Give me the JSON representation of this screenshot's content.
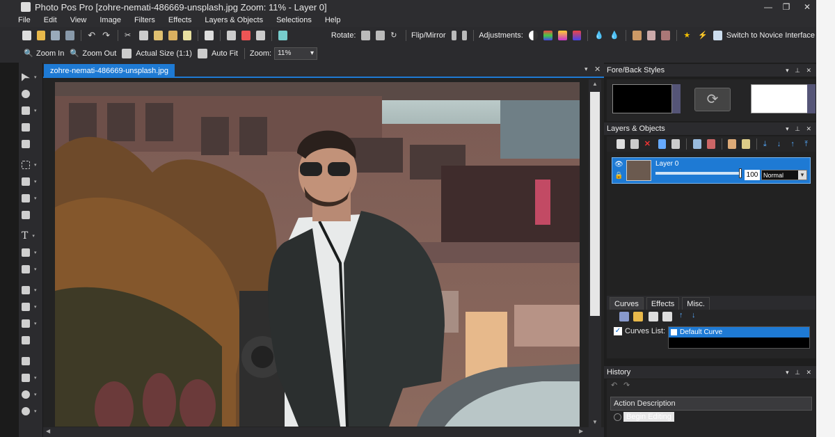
{
  "app": {
    "title": "Photo Pos Pro [zohre-nemati-486669-unsplash.jpg Zoom: 11% - Layer 0]"
  },
  "menu": [
    "File",
    "Edit",
    "View",
    "Image",
    "Filters",
    "Effects",
    "Layers & Objects",
    "Selections",
    "Help"
  ],
  "toolbar": {
    "rotate_label": "Rotate:",
    "flip_label": "Flip/Mirror",
    "adjustments_label": "Adjustments:",
    "novice_label": "Switch to Novice Interface",
    "zoom_in": "Zoom In",
    "zoom_out": "Zoom Out",
    "actual_size": "Actual Size (1:1)",
    "auto_fit": "Auto Fit",
    "zoom_label": "Zoom:",
    "zoom_value": "11%"
  },
  "document": {
    "tab": "zohre-nemati-486669-unsplash.jpg"
  },
  "panels": {
    "fore_back": "Fore/Back Styles",
    "layers": "Layers & Objects",
    "history": "History"
  },
  "layer": {
    "name": "Layer 0",
    "opacity": "100",
    "blend": "Normal",
    "opacity_fraction": 1.0
  },
  "curves": {
    "tabs": [
      "Curves",
      "Effects",
      "Misc."
    ],
    "list_label": "Curves List:",
    "selected": "Default Curve"
  },
  "history": {
    "column": "Action Description",
    "first": "Begin Editing"
  },
  "colors": {
    "accent": "#1e7ad4",
    "fore": "#000000",
    "back": "#ffffff"
  }
}
